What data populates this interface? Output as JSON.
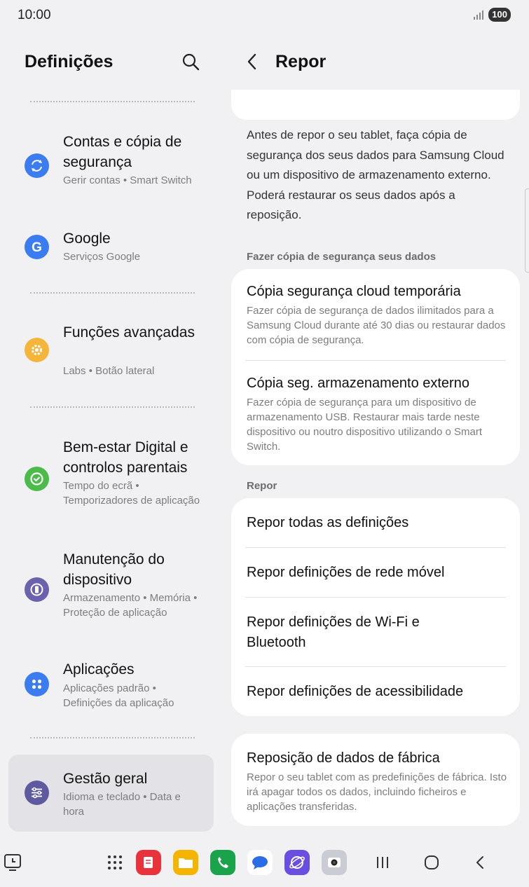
{
  "status": {
    "time": "10:00",
    "battery": "100"
  },
  "left": {
    "title": "Definições",
    "items": [
      {
        "title": "Contas e cópia de segurança",
        "sub": "Gerir contas  •  Smart Switch",
        "color": "#3b7df0",
        "icon": "sync-icon"
      },
      {
        "title": "Google",
        "sub": "Serviços Google",
        "color": "#3b7df0",
        "icon": "google-icon"
      },
      {
        "title": "Funções avançadas",
        "sub": "Labs  •  Botão lateral",
        "color": "#f5b43a",
        "icon": "gear-plus-icon"
      },
      {
        "title": "Bem-estar Digital e controlos parentais",
        "sub": "Tempo do ecrã  •  Temporizadores de aplicação",
        "color": "#4cbb4a",
        "icon": "wellbeing-icon"
      },
      {
        "title": "Manutenção do dispositivo",
        "sub": "Armazenamento  •  Memória  •  Proteção de aplicação",
        "color": "#6a62ad",
        "icon": "device-care-icon"
      },
      {
        "title": "Aplicações",
        "sub": "Aplicações padrão  •  Definições da aplicação",
        "color": "#3b7df0",
        "icon": "apps-icon"
      },
      {
        "title": "Gestão geral",
        "sub": "Idioma e teclado  •  Data e hora",
        "color": "#5e5aa0",
        "icon": "sliders-icon"
      }
    ]
  },
  "right": {
    "title": "Repor",
    "intro": "Antes de repor o seu tablet, faça cópia de segurança dos seus dados para Samsung Cloud ou um dispositivo de armazenamento externo. Poderá restaurar os seus dados após a reposição.",
    "backup_section": "Fazer cópia de segurança seus dados",
    "backup_items": [
      {
        "title": "Cópia segurança cloud temporária",
        "sub": "Fazer cópia de segurança de dados ilimitados para a Samsung Cloud durante até 30 dias ou restaurar dados com cópia de segurança."
      },
      {
        "title": "Cópia seg. armazenamento externo",
        "sub": "Fazer cópia de segurança para um dispositivo de armazenamento USB. Restaurar mais tarde neste dispositivo ou noutro dispositivo utilizando o Smart Switch."
      }
    ],
    "reset_section": "Repor",
    "reset_items": [
      {
        "title": "Repor todas as definições"
      },
      {
        "title": "Repor definições de rede móvel"
      },
      {
        "title": "Repor definições de Wi-Fi e Bluetooth"
      },
      {
        "title": "Repor definições de acessibilidade"
      }
    ],
    "factory": {
      "title": "Reposição de dados de fábrica",
      "sub": "Repor o seu tablet com as predefinições de fábrica. Isto irá apagar todos os dados, incluindo ficheiros e aplicações transferidas."
    }
  },
  "taskbar": {
    "apps": [
      {
        "icon": "notes-app-icon",
        "color": "#e8323c"
      },
      {
        "icon": "files-app-icon",
        "color": "#f5b400"
      },
      {
        "icon": "phone-app-icon",
        "color": "#1aa34a"
      },
      {
        "icon": "messages-app-icon",
        "color": "#2b6de6"
      },
      {
        "icon": "internet-app-icon",
        "color": "#6a4ee0"
      },
      {
        "icon": "camera-app-icon",
        "color": "#c9ccd2"
      }
    ]
  }
}
